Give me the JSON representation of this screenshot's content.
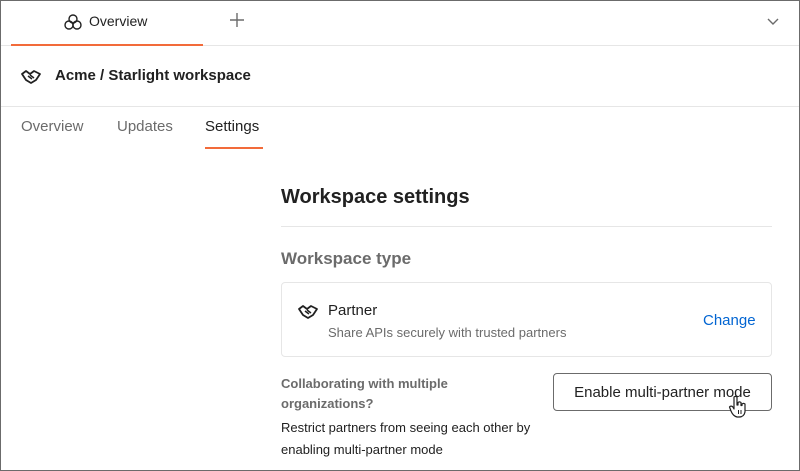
{
  "tabbar": {
    "active_tab_label": "Overview",
    "active_tab_icon": "team-icon",
    "new_tab_icon": "plus-icon",
    "menu_icon": "chevron-down-icon",
    "accent_color": "#f26b3a"
  },
  "workspace": {
    "title": "Acme / Starlight workspace",
    "icon": "handshake-icon"
  },
  "subnav": {
    "tabs": [
      {
        "label": "Overview",
        "active": false
      },
      {
        "label": "Updates",
        "active": false
      },
      {
        "label": "Settings",
        "active": true
      }
    ]
  },
  "settings": {
    "title": "Workspace settings",
    "type_heading": "Workspace type",
    "type_card": {
      "name": "Partner",
      "description": "Share APIs securely with trusted partners",
      "change_label": "Change",
      "icon": "handshake-icon",
      "link_color": "#0265d2"
    },
    "collab_question": "Collaborating with multiple organizations?",
    "collab_description": "Restrict partners from seeing each other by enabling multi-partner mode",
    "enable_button_label": "Enable multi-partner mode"
  }
}
